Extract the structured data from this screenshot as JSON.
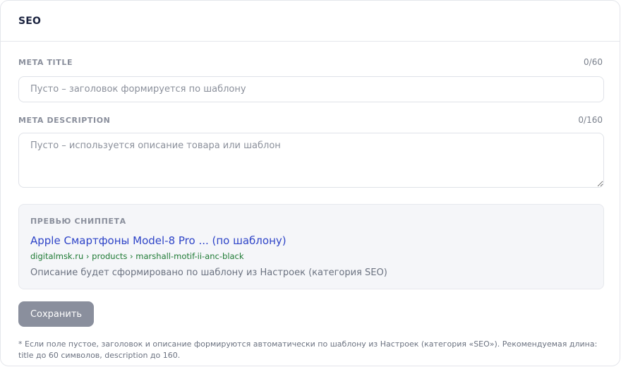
{
  "card": {
    "title": "SEO"
  },
  "meta_title": {
    "label": "META TITLE",
    "counter": "0/60",
    "value": "",
    "placeholder": "Пусто – заголовок формируется по шаблону"
  },
  "meta_description": {
    "label": "META DESCRIPTION",
    "counter": "0/160",
    "value": "",
    "placeholder": "Пусто – используется описание товара или шаблон"
  },
  "snippet": {
    "label": "ПРЕВЬЮ СНИППЕТА",
    "title": "Apple Смартфоны Model-8 Pro ... (по шаблону)",
    "url": "digitalmsk.ru › products › marshall-motif-ii-anc-black",
    "description": "Описание будет сформировано по шаблону из Настроек (категория SEO)"
  },
  "actions": {
    "save_label": "Сохранить"
  },
  "footnote": "* Если поле пустое, заголовок и описание формируются автоматически по шаблону из Настроек (категория «SEO»). Рекомендуемая длина: title до 60 символов, description до 160.",
  "colors": {
    "snippet_title": "#2f45c8",
    "snippet_url": "#1e7a34",
    "button_bg": "#8a8f9d"
  }
}
